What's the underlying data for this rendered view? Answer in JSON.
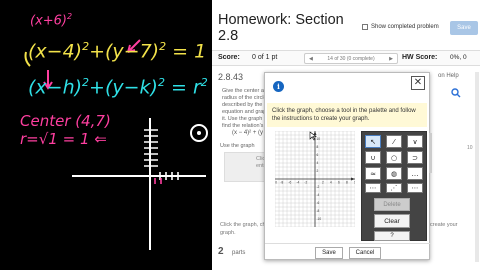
{
  "board": {
    "line1": "(x+6)",
    "line1_exp": "2",
    "line2": "(x−4)",
    "line2_rest": "+(y−7)",
    "line2_end": "= 1",
    "line3": "(x−h)",
    "line3_rest": "+(y−k)",
    "line3_end": "= r",
    "center_label": "Center (4,7)",
    "radius_label": "r=√1 = 1 ⇐",
    "colors": {
      "yellow": "#f2e24a",
      "pink": "#ff3fa0",
      "cyan": "#2fe0e6",
      "white": "#ffffff"
    }
  },
  "page": {
    "title": "Homework: Section 2.8",
    "show_completed": "Show completed problem",
    "save_top": "Save",
    "score_label": "Score:",
    "score_value": "0 of 1 pt",
    "question_nav": "14 of 30 (0 complete)",
    "hw_score_label": "HW Score:",
    "hw_score_value": "0%, 0",
    "question_number": "2.8.43",
    "help_link": "on Help",
    "prompt": "Give the center and radius of the circle described by the equation and graph it. Use the graph to find the relation's domain and range.",
    "equation": "(x − 4)² + (y − 7)² = 1",
    "use_graph": "Use the graph",
    "bg_box_text": "Click ente",
    "click_graph": "Click the graph, choose a tool in the palette and follow the instructions to create your",
    "graph_word": "graph.",
    "create_your": "create your",
    "bg_tick": "10",
    "parts_num": "2",
    "parts_text": "parts"
  },
  "modal": {
    "instructions": "Click the graph, choose a tool in the palette and follow the instructions to create your graph.",
    "tools": [
      "↖",
      "⁄",
      "∨",
      "∪",
      "○",
      "⊃",
      "≈",
      "◍",
      "…",
      "⋯",
      "⋰",
      "⋯"
    ],
    "delete_label": "Delete",
    "clear_label": "Clear",
    "help_label": "?",
    "save_label": "Save",
    "cancel_label": "Cancel",
    "graph_ticks": [
      "-10",
      "-8",
      "-6",
      "-4",
      "-2",
      "2",
      "4",
      "6",
      "8",
      "10"
    ]
  }
}
